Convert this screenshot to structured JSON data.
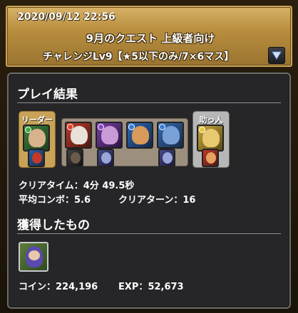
{
  "header": {
    "datetime": "2020/09/12 22:56",
    "quest_title": "9月のクエスト 上級者向け",
    "stage_name": "チャレンジLv9【★5以下のみ/7×6マス】"
  },
  "result": {
    "title": "プレイ結果",
    "leader_label": "リーダー",
    "helper_label": "助っ人",
    "clear_time_label": "クリアタイム：",
    "clear_time_value": "4分 49.5秒",
    "avg_combo_label": "平均コンボ：",
    "avg_combo_value": "5.6",
    "clear_turn_label": "クリアターン：",
    "clear_turn_value": "16"
  },
  "obtained": {
    "title": "獲得したもの",
    "coin_label": "コイン：",
    "coin_value": "224,196",
    "exp_label": "EXP：",
    "exp_value": "52,673"
  },
  "colors": {
    "fire": "#e0402c",
    "water": "#3a7bd5",
    "wood": "#3fae3f",
    "light": "#e8c840",
    "dark": "#8a46c4"
  }
}
